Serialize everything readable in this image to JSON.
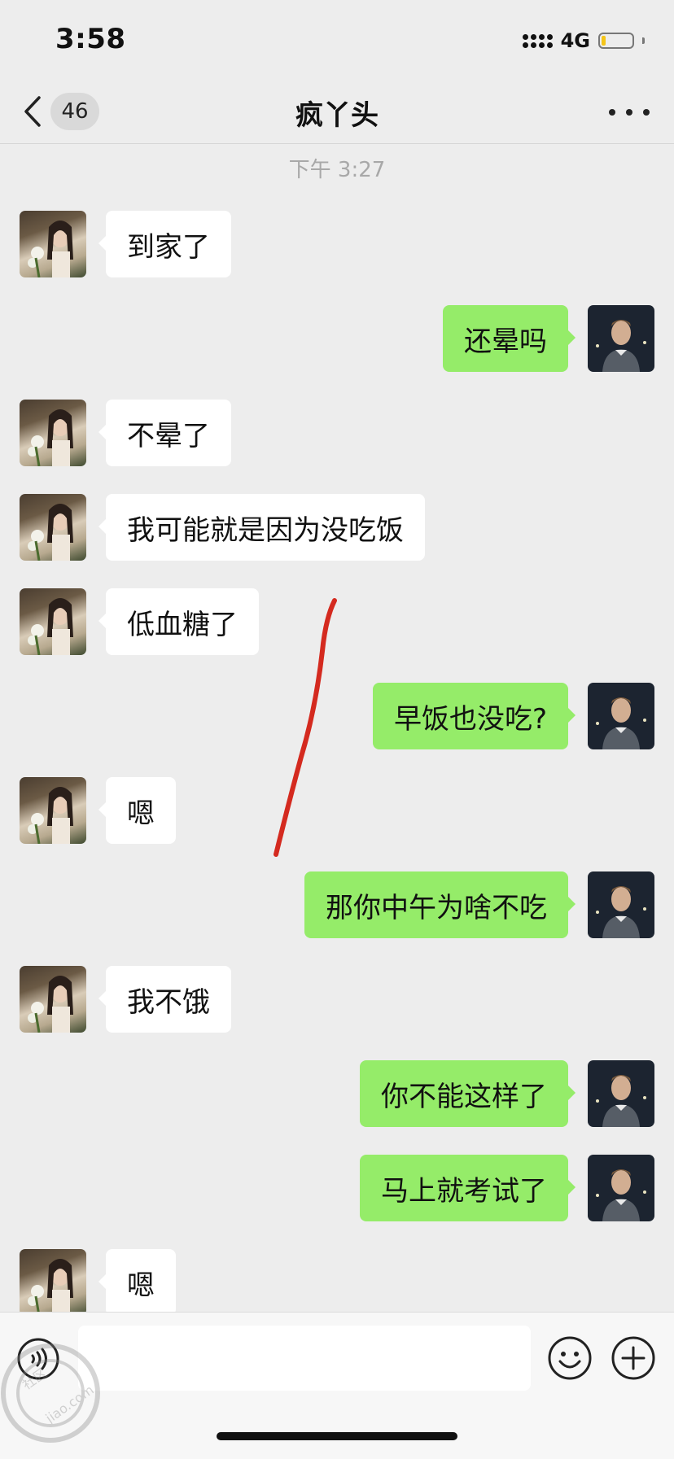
{
  "status_bar": {
    "time": "3:58",
    "network": "4G",
    "battery_level": 0.15,
    "colors": {
      "battery": "#f5c518"
    }
  },
  "nav": {
    "back_icon": "chevron-left-icon",
    "unread_count": "46",
    "title": "疯丫头",
    "more_icon": "more-dots-icon"
  },
  "chat": {
    "timestamp": "下午 3:27",
    "messages": [
      {
        "side": "in",
        "text": "到家了"
      },
      {
        "side": "out",
        "text": "还晕吗"
      },
      {
        "side": "in",
        "text": "不晕了"
      },
      {
        "side": "in",
        "text": "我可能就是因为没吃饭"
      },
      {
        "side": "in",
        "text": "低血糖了"
      },
      {
        "side": "out",
        "text": "早饭也没吃?"
      },
      {
        "side": "in",
        "text": "嗯"
      },
      {
        "side": "out",
        "text": "那你中午为啥不吃"
      },
      {
        "side": "in",
        "text": "我不饿"
      },
      {
        "side": "out",
        "text": "你不能这样了"
      },
      {
        "side": "out",
        "text": "马上就考试了"
      },
      {
        "side": "in",
        "text": "嗯"
      }
    ],
    "colors": {
      "outgoing_bubble": "#95ec69",
      "incoming_bubble": "#ffffff",
      "background": "#ededed",
      "annotation_stroke": "#d42a1f"
    }
  },
  "input_bar": {
    "voice_icon": "voice-icon",
    "emoji_icon": "emoji-icon",
    "plus_icon": "plus-icon",
    "placeholder": ""
  },
  "watermark": {
    "text": "jiao.com",
    "brand": "社区"
  }
}
